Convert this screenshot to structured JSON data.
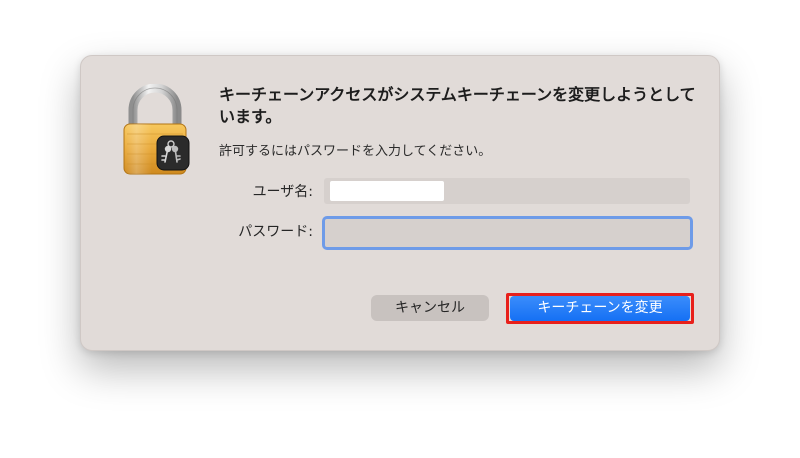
{
  "dialog": {
    "title": "キーチェーンアクセスがシステムキーチェーンを変更しようとしています。",
    "message": "許可するにはパスワードを入力してください。",
    "username_label": "ユーザ名:",
    "username_value": "",
    "password_label": "パスワード:",
    "password_value": "",
    "cancel_label": "キャンセル",
    "confirm_label": "キーチェーンを変更"
  },
  "icons": {
    "lock": "keychain-lock-icon"
  },
  "colors": {
    "accent": "#1a73f5",
    "highlight_outline": "#e8201b",
    "focus_ring": "#6e9be8",
    "dialog_background": "#e1dbd8"
  }
}
